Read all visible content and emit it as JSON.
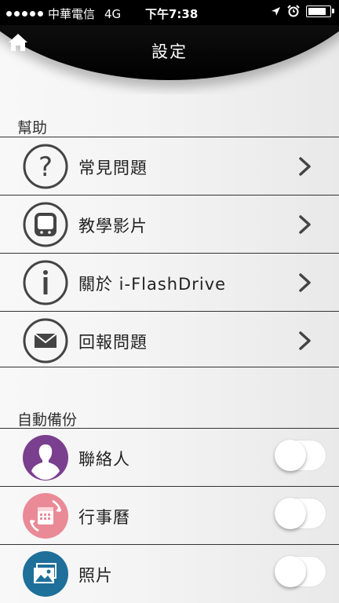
{
  "status_bar": {
    "carrier": "中華電信",
    "network": "4G",
    "time": "下午7:38",
    "battery_level": 0.9
  },
  "header": {
    "title": "設定",
    "home_icon": "home-icon"
  },
  "help_section": {
    "title": "幫助",
    "items": [
      {
        "label": "常見問題",
        "icon": "question-icon"
      },
      {
        "label": "教學影片",
        "icon": "tutorial-video-icon"
      },
      {
        "label": "關於 i-FlashDrive",
        "icon": "info-icon"
      },
      {
        "label": "回報問題",
        "icon": "mail-icon"
      }
    ]
  },
  "backup_section": {
    "title": "自動備份",
    "items": [
      {
        "label": "聯絡人",
        "icon": "contacts-icon",
        "color": "#7b3f8f",
        "enabled": false
      },
      {
        "label": "行事曆",
        "icon": "calendar-icon",
        "color": "#ea8a97",
        "enabled": false
      },
      {
        "label": "照片",
        "icon": "photos-icon",
        "color": "#1f6f9b",
        "enabled": false
      }
    ]
  }
}
